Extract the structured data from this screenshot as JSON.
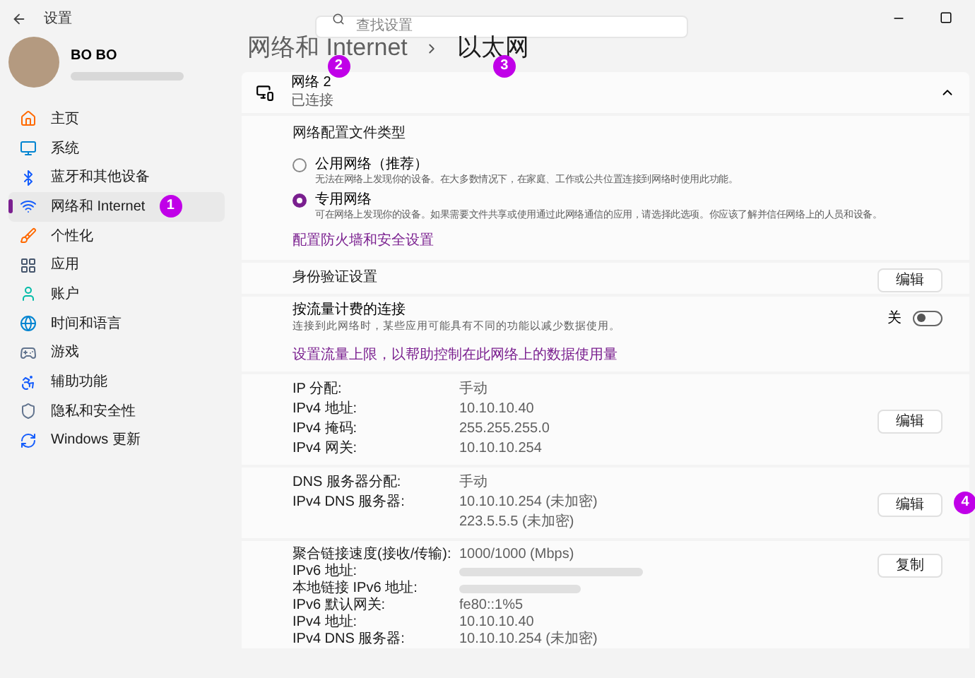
{
  "window": {
    "title": "设置",
    "search_placeholder": "查找设置"
  },
  "user": {
    "name": "BO BO"
  },
  "nav": [
    {
      "label": "主页",
      "selected": false
    },
    {
      "label": "系统",
      "selected": false
    },
    {
      "label": "蓝牙和其他设备",
      "selected": false
    },
    {
      "label": "网络和 Internet",
      "selected": true,
      "badge": "1"
    },
    {
      "label": "个性化",
      "selected": false
    },
    {
      "label": "应用",
      "selected": false
    },
    {
      "label": "账户",
      "selected": false
    },
    {
      "label": "时间和语言",
      "selected": false
    },
    {
      "label": "游戏",
      "selected": false
    },
    {
      "label": "辅助功能",
      "selected": false
    },
    {
      "label": "隐私和安全性",
      "selected": false
    },
    {
      "label": "Windows 更新",
      "selected": false
    }
  ],
  "breadcrumb": [
    {
      "text": "网络和 Internet",
      "badge": "2"
    },
    {
      "text": "以太网",
      "badge": "3"
    }
  ],
  "network": {
    "name": "网络 2",
    "status": "已连接",
    "expanded": true
  },
  "profile": {
    "title": "网络配置文件类型",
    "options": [
      {
        "label": "公用网络（推荐）",
        "description": "无法在网络上发现你的设备。在大多数情况下，在家庭、工作或公共位置连接到网络时使用此功能。",
        "selected": false
      },
      {
        "label": "专用网络",
        "description": "可在网络上发现你的设备。如果需要文件共享或使用通过此网络通信的应用，请选择此选项。你应该了解并信任网络上的人员和设备。",
        "selected": true
      }
    ],
    "link": "配置防火墙和安全设置"
  },
  "auth": {
    "label": "身份验证设置",
    "button": "编辑"
  },
  "metered": {
    "label": "按流量计费的连接",
    "description": "连接到此网络时，某些应用可能具有不同的功能以减少数据使用。",
    "toggle_label": "关",
    "on": false,
    "link": "设置流量上限，以帮助控制在此网络上的数据使用量"
  },
  "ip": {
    "button": "编辑",
    "rows": [
      {
        "label": "IP 分配:",
        "value": "手动"
      },
      {
        "label": "IPv4 地址:",
        "value": "10.10.10.40"
      },
      {
        "label": "IPv4 掩码:",
        "value": "255.255.255.0"
      },
      {
        "label": "IPv4 网关:",
        "value": "10.10.10.254"
      }
    ]
  },
  "dns": {
    "button": "编辑",
    "badge": "4",
    "rows": [
      {
        "label": "DNS 服务器分配:",
        "values": [
          "手动"
        ]
      },
      {
        "label": "IPv4 DNS 服务器:",
        "values": [
          "10.10.10.254 (未加密)",
          "223.5.5.5 (未加密)"
        ]
      }
    ]
  },
  "details": {
    "button": "复制",
    "rows": [
      {
        "kind": "text",
        "label": "聚合链接速度(接收/传输):",
        "value": "1000/1000 (Mbps)"
      },
      {
        "kind": "blurred",
        "label": "IPv6 地址:"
      },
      {
        "kind": "blurred",
        "label": "本地链接 IPv6 地址:"
      },
      {
        "kind": "text",
        "label": "IPv6 默认网关:",
        "value": "fe80::1%5"
      },
      {
        "kind": "text",
        "label": "IPv4 地址:",
        "value": "10.10.10.40"
      },
      {
        "kind": "text",
        "label": "IPv4 DNS 服务器:",
        "value": "10.10.10.254 (未加密)"
      }
    ]
  }
}
